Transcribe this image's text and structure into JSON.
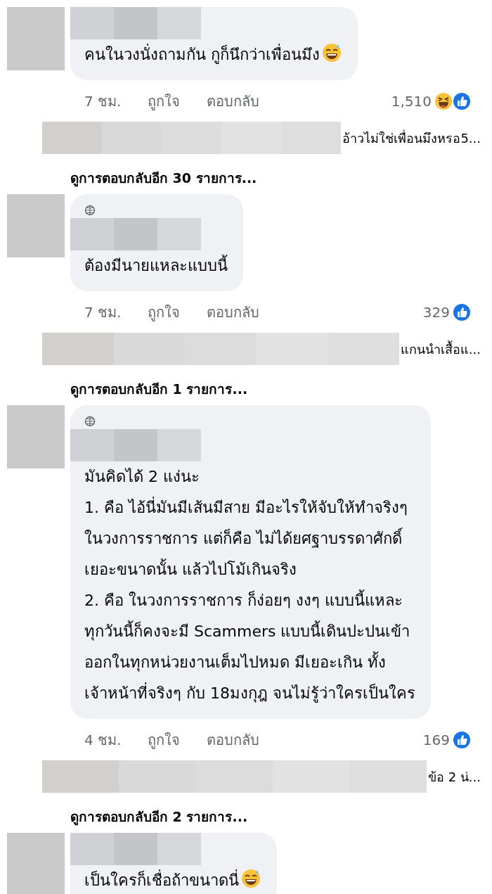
{
  "threads": [
    {
      "top_fan": false,
      "lines": [
        "คนในวงนั่งถามกัน กูก็นึกว่าเพื่อนมึง"
      ],
      "emoji_end": true,
      "time": "7 ชม.",
      "like": "ถูกใจ",
      "reply": "ตอบกลับ",
      "count": "1,510",
      "reactions": [
        {
          "kind": "haha"
        },
        {
          "kind": "like"
        }
      ],
      "reply_preview": "อ้าวไม่ใช่เพื่อนมึงหรอ5...",
      "more_replies": "ดูการตอบกลับอีก 30 รายการ..."
    },
    {
      "top_fan": true,
      "lines": [
        "ต้องมีนายแหละแบบนี้"
      ],
      "emoji_end": false,
      "time": "7 ชม.",
      "like": "ถูกใจ",
      "reply": "ตอบกลับ",
      "count": "329",
      "reactions": [
        {
          "kind": "like"
        }
      ],
      "reply_preview": "แกนนำเสื้อแ...",
      "more_replies": "ดูการตอบกลับอีก 1 รายการ..."
    },
    {
      "top_fan": true,
      "lines": [
        "มันคิดได้ 2 แง่นะ",
        "1. คือ ไอ้นี่มันมีเส้นมีสาย มีอะไรให้จับให้ทำจริงๆ",
        "ในวงการราชการ แต่ก็คือ ไม่ได้ยศฐาบรรดาศักดิ์",
        "เยอะขนาดนั้น แล้วไปโม้เกินจริง",
        "2. คือ ในวงการราชการ ก็ง่อยๆ งงๆ แบบนี้แหละ",
        "ทุกวันนี้ก็คงจะมี Scammers แบบนี้เดินปะปนเข้า",
        "ออกในทุกหน่วยงานเต็มไปหมด มีเยอะเกิน ทั้ง",
        "เจ้าหน้าที่จริงๆ กับ 18มงกุฎ จนไม่รู้ว่าใครเป็นใคร"
      ],
      "emoji_end": false,
      "time": "4 ชม.",
      "like": "ถูกใจ",
      "reply": "ตอบกลับ",
      "count": "169",
      "reactions": [
        {
          "kind": "like"
        }
      ],
      "reply_preview": "ข้อ 2 น่...",
      "more_replies": "ดูการตอบกลับอีก 2 รายการ..."
    },
    {
      "top_fan": false,
      "lines": [
        "เป็นใครก็เชื่อถ้าขนาดนี่"
      ],
      "emoji_end": true
    }
  ]
}
